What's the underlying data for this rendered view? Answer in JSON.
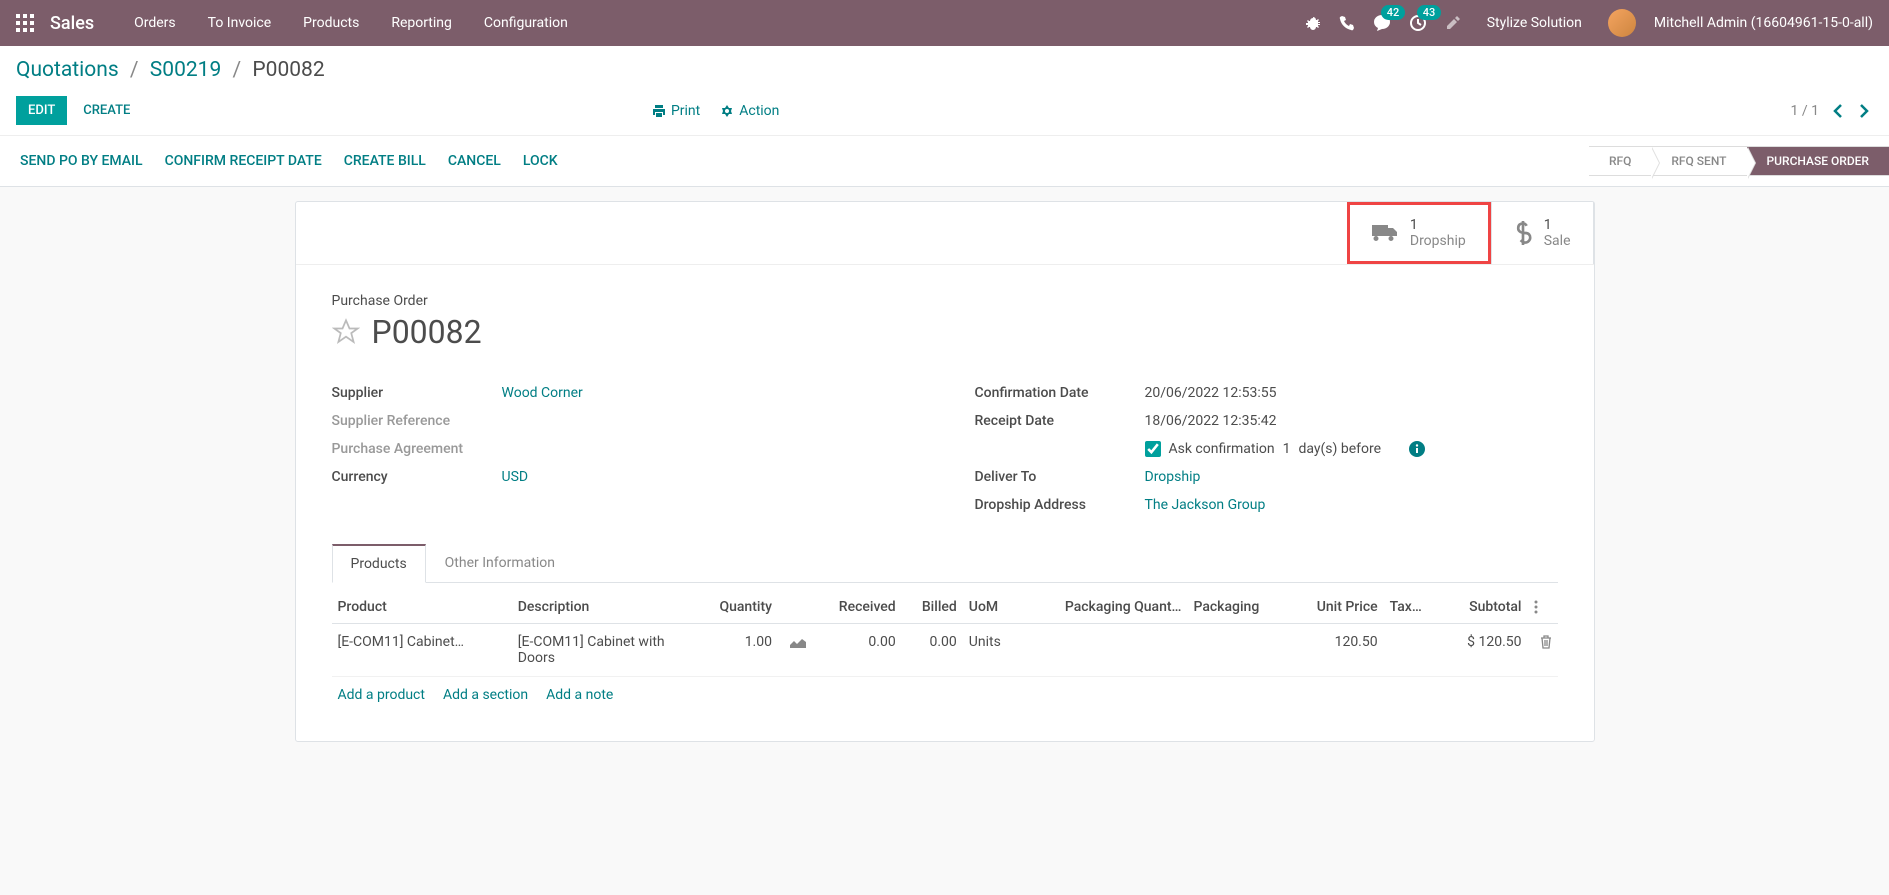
{
  "nav": {
    "title": "Sales",
    "items": [
      "Orders",
      "To Invoice",
      "Products",
      "Reporting",
      "Configuration"
    ],
    "messages_badge": "42",
    "activities_badge": "43",
    "company": "Stylize Solution",
    "user": "Mitchell Admin (16604961-15-0-all)"
  },
  "breadcrumb": {
    "root": "Quotations",
    "mid": "S00219",
    "current": "P00082"
  },
  "controls": {
    "edit": "EDIT",
    "create": "CREATE",
    "print": "Print",
    "action": "Action",
    "pager": "1 / 1"
  },
  "statusbar": {
    "actions": [
      "SEND PO BY EMAIL",
      "CONFIRM RECEIPT DATE",
      "CREATE BILL",
      "CANCEL",
      "LOCK"
    ],
    "states": [
      "RFQ",
      "RFQ SENT",
      "PURCHASE ORDER"
    ]
  },
  "stat_buttons": {
    "dropship": {
      "count": "1",
      "label": "Dropship"
    },
    "sale": {
      "count": "1",
      "label": "Sale"
    }
  },
  "header": {
    "label": "Purchase Order",
    "number": "P00082"
  },
  "fields_left": {
    "supplier": {
      "label": "Supplier",
      "value": "Wood Corner"
    },
    "supplier_ref": {
      "label": "Supplier Reference",
      "value": ""
    },
    "purchase_agreement": {
      "label": "Purchase Agreement",
      "value": ""
    },
    "currency": {
      "label": "Currency",
      "value": "USD"
    }
  },
  "fields_right": {
    "confirmation_date": {
      "label": "Confirmation Date",
      "value": "20/06/2022 12:53:55"
    },
    "receipt_date": {
      "label": "Receipt Date",
      "value": "18/06/2022 12:35:42"
    },
    "ask_confirm": {
      "prefix": "Ask confirmation",
      "days": "1",
      "suffix": "day(s) before"
    },
    "deliver_to": {
      "label": "Deliver To",
      "value": "Dropship"
    },
    "dropship_address": {
      "label": "Dropship Address",
      "value": "The Jackson Group"
    }
  },
  "tabs": [
    "Products",
    "Other Information"
  ],
  "table": {
    "headers": [
      "Product",
      "Description",
      "Quantity",
      "Received",
      "Billed",
      "UoM",
      "Packaging Quant…",
      "Packaging",
      "Unit Price",
      "Tax…",
      "Subtotal"
    ],
    "row": {
      "product": "[E-COM11] Cabinet…",
      "description": "[E-COM11] Cabinet with Doors",
      "quantity": "1.00",
      "received": "0.00",
      "billed": "0.00",
      "uom": "Units",
      "pack_qty": "",
      "packaging": "",
      "unit_price": "120.50",
      "taxes": "",
      "subtotal": "$ 120.50"
    },
    "actions": [
      "Add a product",
      "Add a section",
      "Add a note"
    ]
  }
}
